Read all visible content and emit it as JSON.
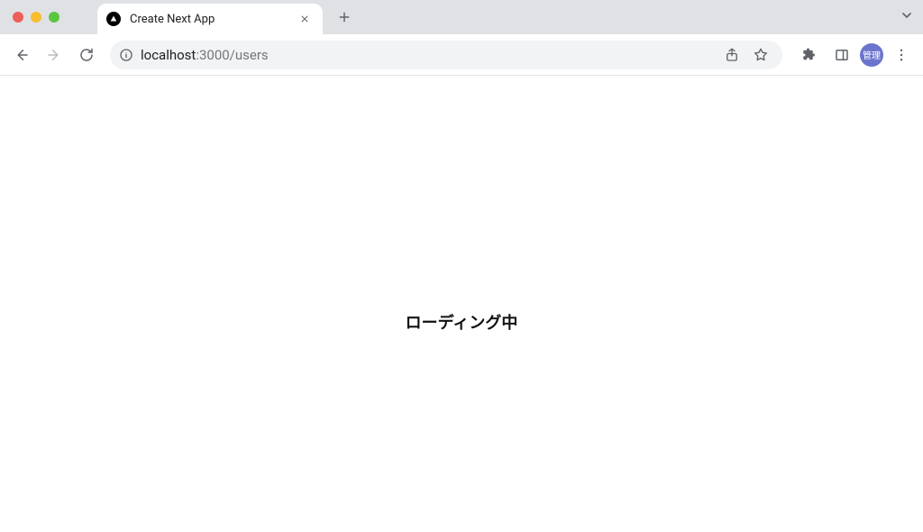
{
  "browser": {
    "tab": {
      "title": "Create Next App"
    },
    "url": {
      "host": "localhost",
      "port_path": ":3000/users"
    },
    "avatar_label": "管理"
  },
  "page": {
    "loading_text": "ローディング中"
  }
}
